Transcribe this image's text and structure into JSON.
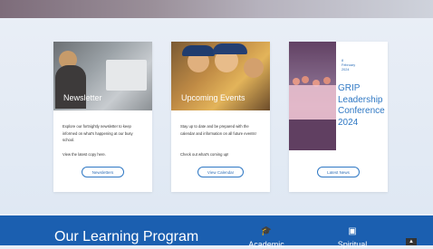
{
  "cards": {
    "newsletter": {
      "caption": "Newsletter",
      "body": "Explore our fortnightly newsletter to keep informed on what's happening at our busy school.",
      "body2": "View the latest copy here.",
      "button": "Newsletters"
    },
    "events": {
      "caption": "Upcoming Events",
      "body": "Stay up to date and be prepared with the calendar and information on all future events!",
      "body2": "Check out what's coming up!",
      "button": "View Calendar"
    },
    "news": {
      "date_day": "8",
      "date_month": "February",
      "date_year": "2024",
      "title": "GRIP Leadership Conference 2024",
      "button": "Latest News"
    }
  },
  "footer": {
    "title": "Our Learning Program",
    "items": [
      {
        "label": "Academic",
        "icon": "graduation-cap-icon"
      },
      {
        "label": "Spiritual",
        "icon": "bible-icon"
      }
    ],
    "scroll_top_icon": "chevron-up-icon"
  },
  "colors": {
    "accent": "#2f78c4",
    "footer": "#1b5fb0",
    "background": "#e8eef6"
  }
}
